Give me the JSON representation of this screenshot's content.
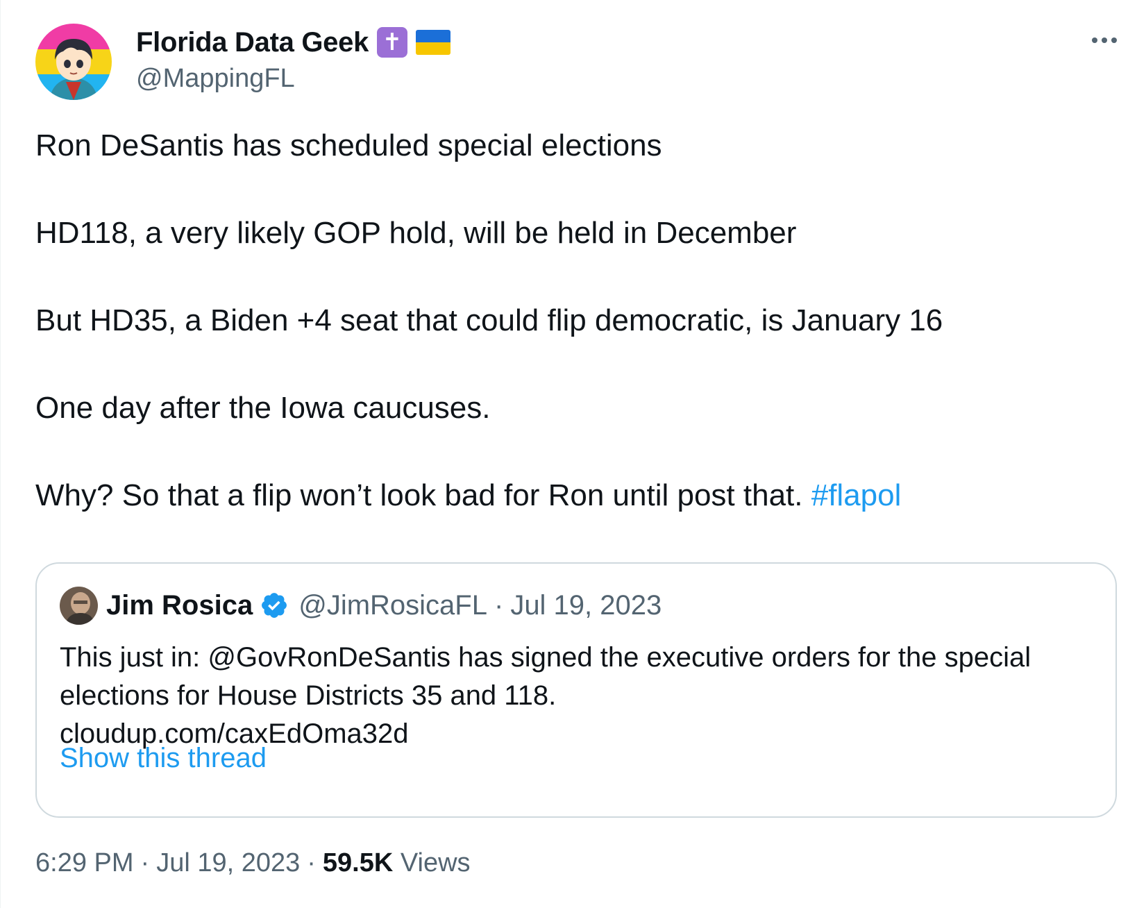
{
  "author": {
    "display_name": "Florida Data Geek",
    "badges": [
      "latin-cross-emoji",
      "ukraine-flag-emoji"
    ],
    "handle": "@MappingFL"
  },
  "more_icon": "more-horizontal-icon",
  "tweet": {
    "paragraphs": [
      "Ron DeSantis has scheduled special elections",
      "HD118, a very likely GOP hold, will be held in December",
      "But HD35, a Biden +4 seat that could flip democratic, is January 16",
      "One day after the Iowa caucuses."
    ],
    "last_paragraph": "Why?  So that a flip won’t look bad for Ron until post that.",
    "hashtag": "#flapol"
  },
  "quoted_tweet": {
    "name": "Jim Rosica",
    "verified": true,
    "handle": "@JimRosicaFL",
    "separator": "·",
    "date": "Jul 19, 2023",
    "text_line1": "This just in: @GovRonDeSantis has signed the executive orders for the special",
    "text_line2": "elections for House Districts 35 and 118.",
    "text_line3": "cloudup.com/caxEdOma32d",
    "show_thread": "Show this thread"
  },
  "meta": {
    "time": "6:29 PM",
    "sep1": "·",
    "date": "Jul 19, 2023",
    "sep2": "·",
    "views_count": "59.5K",
    "views_label": "Views"
  },
  "colors": {
    "link": "#1d9bf0",
    "secondary_text": "#536471",
    "primary_text": "#0f1419",
    "border": "#cfd9de"
  }
}
